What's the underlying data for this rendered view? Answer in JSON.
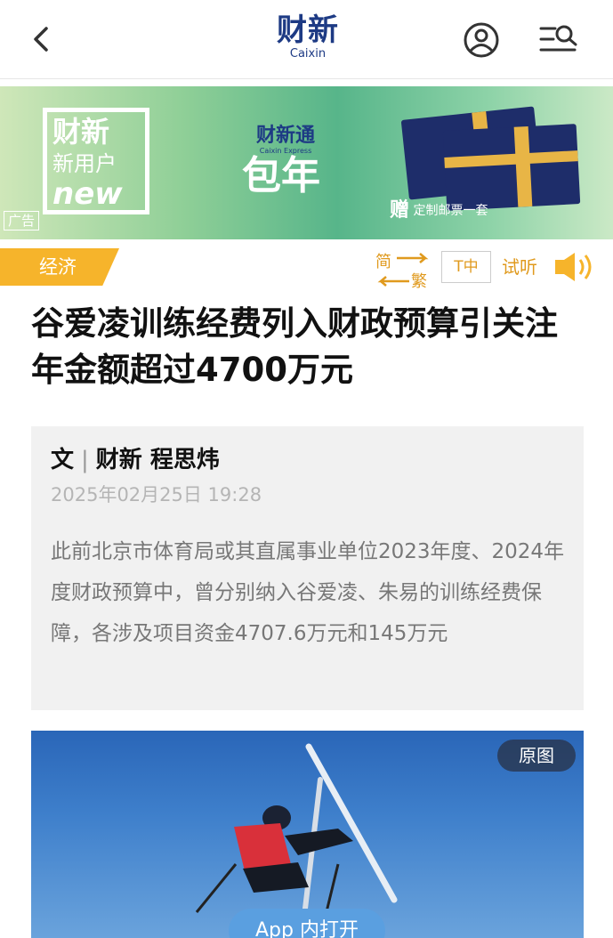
{
  "header": {
    "logo_cn": "财新",
    "logo_en": "Caixin"
  },
  "banner": {
    "new_user_line1": "财新",
    "new_user_line2": "新用户",
    "new_user_line3": "new",
    "express_cn": "财新通",
    "express_en": "Caixin Express",
    "offer": "包年",
    "gift_prefix": "赠",
    "gift_text": "定制邮票一套",
    "ad_label": "广告"
  },
  "category": "经济",
  "tools": {
    "simplified": "简",
    "traditional": "繁",
    "font_size": "T中",
    "listen": "试听"
  },
  "article": {
    "title": "谷爱凌训练经费列入财政预算引关注 年金额超过4700万元",
    "byline_prefix": "文",
    "byline_source": "财新",
    "byline_author": "程思炜",
    "date": "2025年02月25日 19:28",
    "summary": "此前北京市体育局或其直属事业单位2023年度、2024年度财政预算中，曾分别纳入谷爱凌、朱易的训练经费保障，各涉及项目资金4707.6万元和145万元"
  },
  "photo": {
    "original_button": "原图",
    "open_in_app": "App 内打开"
  },
  "colors": {
    "brand_blue": "#1d3a84",
    "accent_orange": "#f6b42b",
    "tool_orange": "#e09a1e"
  }
}
